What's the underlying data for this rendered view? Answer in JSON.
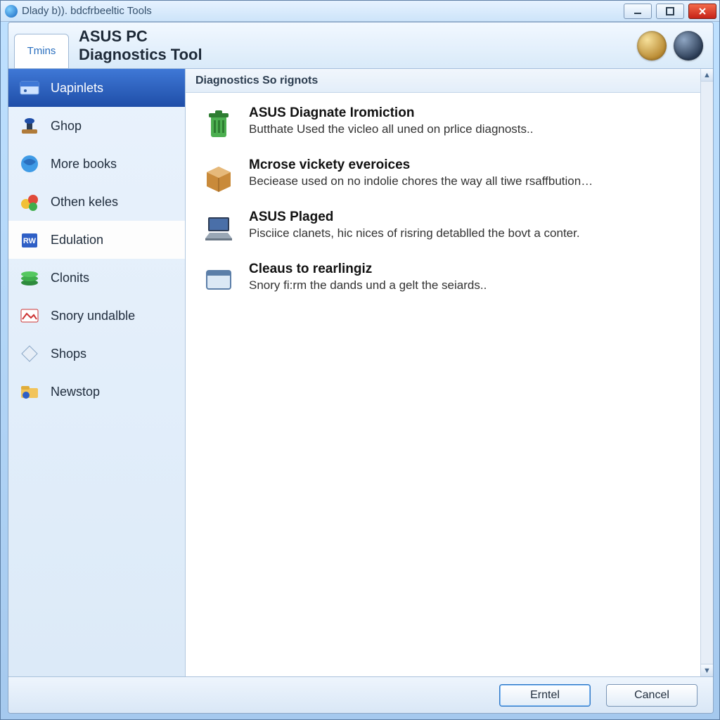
{
  "titlebar": {
    "text": "Dlady b)). bdcfrbeeltic Tools"
  },
  "header": {
    "tab_label": "Tmins",
    "line1": "ASUS PC",
    "line2": "Diagnostics Tool"
  },
  "sidebar": {
    "items": [
      {
        "label": "Uapinlets",
        "icon": "hdd-icon"
      },
      {
        "label": "Ghop",
        "icon": "stamp-icon"
      },
      {
        "label": "More books",
        "icon": "globe-icon"
      },
      {
        "label": "Othen keles",
        "icon": "shapes-icon"
      },
      {
        "label": "Edulation",
        "icon": "blue-cube-icon"
      },
      {
        "label": "Clonits",
        "icon": "green-stack-icon"
      },
      {
        "label": "Snory undalble",
        "icon": "photo-icon"
      },
      {
        "label": "Shops",
        "icon": "diamond-icon"
      },
      {
        "label": "Newstop",
        "icon": "folder-gear-icon"
      }
    ]
  },
  "content": {
    "heading": "Diagnostics So rignots",
    "items": [
      {
        "title": "ASUS Diagnate Iromiction",
        "desc": "Butthate Used the vicleo all uned on prlice diagnosts..",
        "icon": "recycle-bin-icon"
      },
      {
        "title": "Mcrose vickety everoices",
        "desc": "Beciease used on no indolie chores the way all tiwe rsaffbution…",
        "icon": "box-icon"
      },
      {
        "title": "ASUS Plaged",
        "desc": "Pisciice clanets, hic nices of risring detablled the bovt a conter.",
        "icon": "laptop-icon"
      },
      {
        "title": "Cleaus to rearlingiz",
        "desc": "Snory fi:rm the dands und a gelt the seiards..",
        "icon": "window-icon"
      }
    ]
  },
  "footer": {
    "primary_label": "Erntel",
    "cancel_label": "Cancel"
  }
}
